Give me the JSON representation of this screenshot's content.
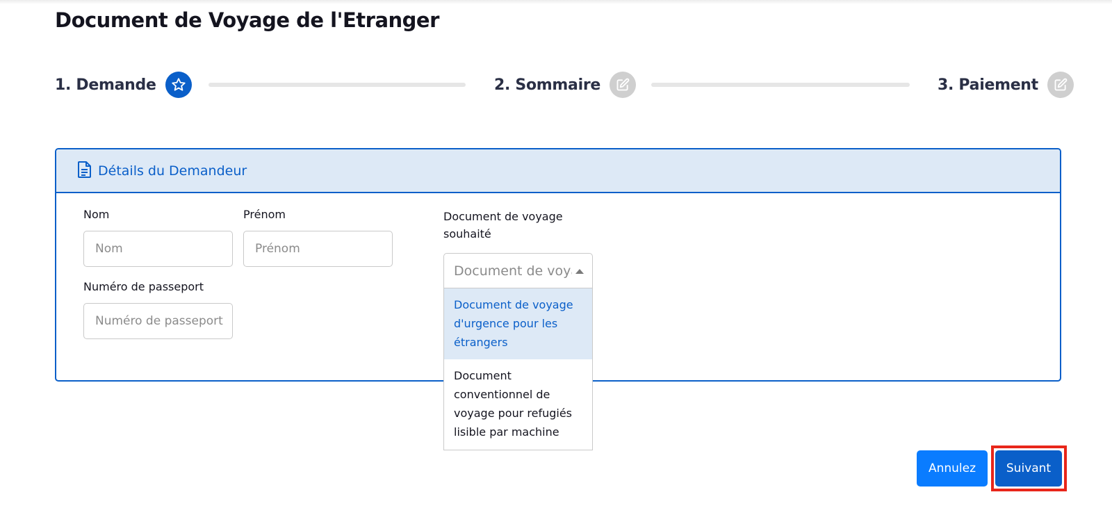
{
  "page": {
    "title": "Document de Voyage de l'Etranger"
  },
  "stepper": {
    "steps": [
      {
        "label": "1. Demande",
        "icon": "star-icon",
        "state": "active"
      },
      {
        "label": "2. Sommaire",
        "icon": "edit-icon",
        "state": "inactive"
      },
      {
        "label": "3. Paiement",
        "icon": "edit-icon",
        "state": "inactive"
      }
    ]
  },
  "card": {
    "title": "Détails du Demandeur",
    "icon": "document-icon"
  },
  "form": {
    "nom": {
      "label": "Nom",
      "placeholder": "Nom",
      "value": ""
    },
    "prenom": {
      "label": "Prénom",
      "placeholder": "Prénom",
      "value": ""
    },
    "passeport": {
      "label": "Numéro de passeport",
      "placeholder": "Numéro de passeport",
      "value": ""
    },
    "document": {
      "label": "Document de voyage souhaité",
      "placeholder": "Document de voyage souhaité",
      "options": [
        "Document de voyage d'urgence pour les étrangers",
        "Document conventionnel de voyage pour refugiés lisible par machine"
      ]
    }
  },
  "buttons": {
    "cancel": "Annulez",
    "next": "Suivant"
  },
  "colors": {
    "primary": "#0a5fc9",
    "cancel": "#0a7cff",
    "header_bg": "#dde9f6",
    "highlight": "#e8261a"
  }
}
